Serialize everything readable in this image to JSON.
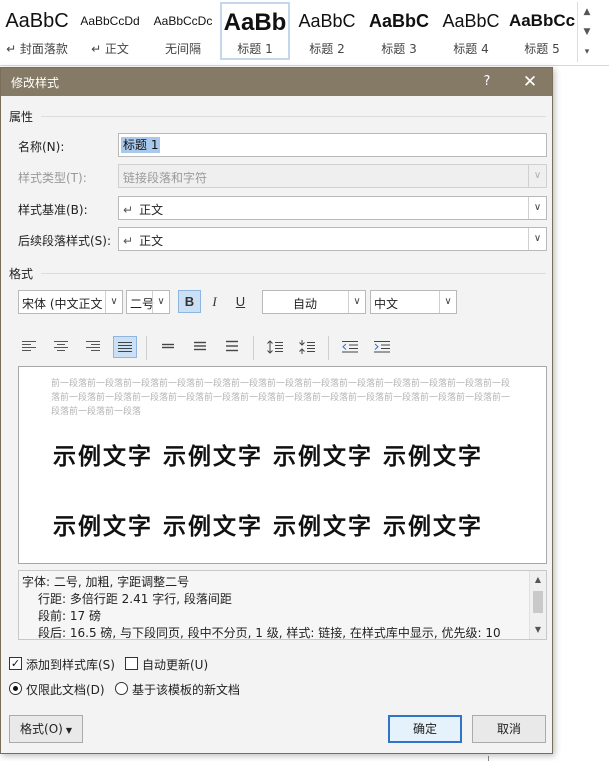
{
  "gallery": {
    "tiles": [
      {
        "sample": "AaBbC",
        "label": "↵ 封面落款"
      },
      {
        "sample": "AaBbCcDd",
        "label": "↵ 正文"
      },
      {
        "sample": "AaBbCcDc",
        "label": "无间隔"
      },
      {
        "sample": "AaBb",
        "label": "标题 1"
      },
      {
        "sample": "AaBbC",
        "label": "标题 2"
      },
      {
        "sample": "AaBbC",
        "label": "标题 3"
      },
      {
        "sample": "AaBbC",
        "label": "标题 4"
      },
      {
        "sample": "AaBbCc",
        "label": "标题 5"
      }
    ],
    "scroll_up": "▲",
    "scroll_down": "▼",
    "more": "▾",
    "launcher": "◢"
  },
  "dialog": {
    "title": "修改样式",
    "help": "?",
    "close": "✕",
    "properties_label": "属性",
    "name_label": "名称(N):",
    "name_value": "标题 1",
    "type_label": "样式类型(T):",
    "type_value": "链接段落和字符",
    "based_label": "样式基准(B):",
    "based_value": "正文",
    "next_label": "后续段落样式(S):",
    "next_value": "正文",
    "return_glyph": "↵",
    "dropdown_arrow": "∨",
    "format_label": "格式",
    "font_value": "宋体 (中文正文",
    "size_value": "二号",
    "bold": "B",
    "italic": "I",
    "underline": "U",
    "color_value": "自动",
    "lang_value": "中文",
    "preview_para": "前一段落前一段落前一段落前一段落前一段落前一段落前一段落前一段落前一段落前一段落前一段落前一段落前一段落前一段落前一段落前一段落前一段落前一段落前一段落前一段落前一段落前一段落前一段落前一段落前一段落前一段落前一段落前一段落",
    "sample_line_1": "示例文字 示例文字 示例文字 示例文字",
    "sample_line_2": "示例文字 示例文字 示例文字 示例文字",
    "description": [
      "字体: 二号, 加粗, 字距调整二号",
      "行距: 多倍行距 2.41 字行, 段落间距",
      "段前: 17 磅",
      "段后: 16.5 磅, 与下段同页, 段中不分页, 1 级, 样式: 链接, 在样式库中显示, 优先级: 10"
    ],
    "add_to_gallery_label": "添加到样式库(S)",
    "auto_update_label": "自动更新(U)",
    "only_this_doc_label": "仅限此文档(D)",
    "new_docs_label": "基于该模板的新文档",
    "format_button": "格式(O)",
    "ok_button": "确定",
    "cancel_button": "取消",
    "checkmark": "✓"
  }
}
